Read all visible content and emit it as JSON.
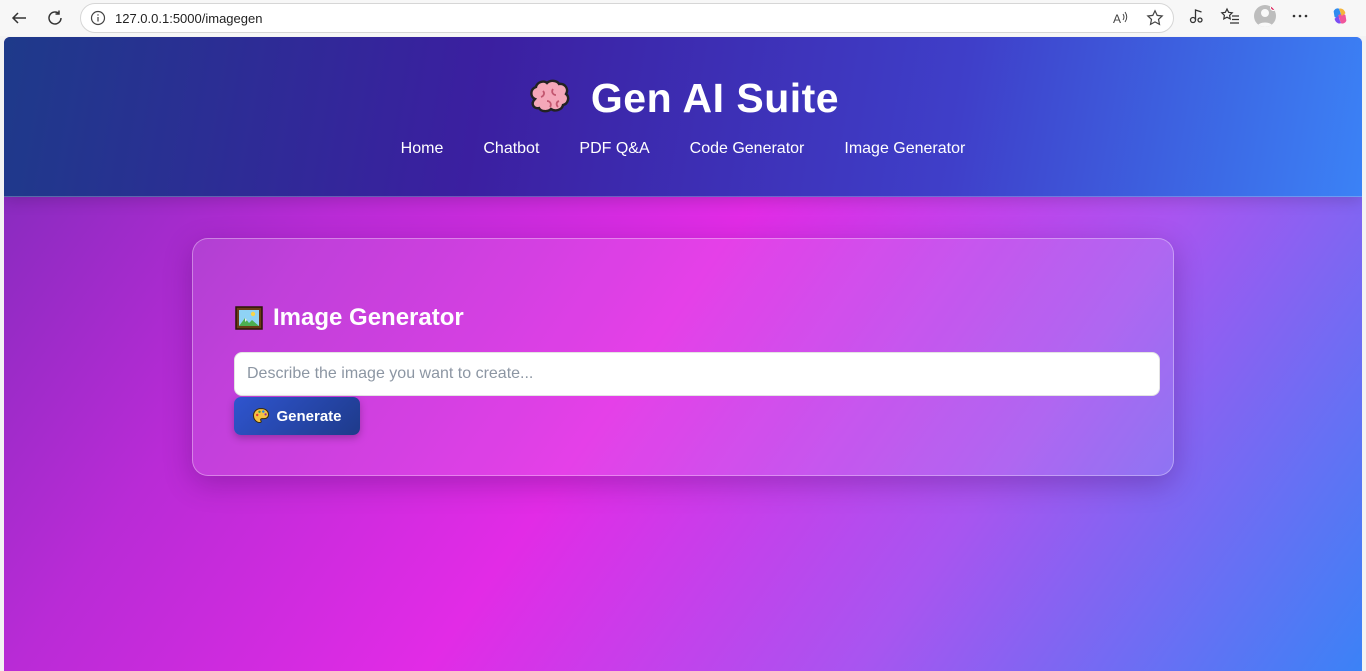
{
  "browser": {
    "url": "127.0.0.1:5000/imagegen"
  },
  "site": {
    "title": "Gen AI Suite",
    "nav": {
      "home": "Home",
      "chatbot": "Chatbot",
      "pdf_qa": "PDF Q&A",
      "code_generator": "Code Generator",
      "image_generator": "Image Generator"
    }
  },
  "card": {
    "title": "Image Generator",
    "prompt_placeholder": "Describe the image you want to create...",
    "prompt_value": "",
    "generate_label": "Generate"
  },
  "colors": {
    "header_start": "#1e3a8a",
    "header_end": "#3b82f6",
    "page_accent": "#e22be6",
    "button": "#2f55cf"
  },
  "icons": [
    "back-arrow-icon",
    "reload-icon",
    "info-icon",
    "read-aloud-icon",
    "favorite-star-icon",
    "media-icon",
    "favorites-list-icon",
    "profile-icon",
    "more-icon",
    "copilot-icon",
    "brain-icon",
    "picture-icon",
    "palette-icon"
  ]
}
